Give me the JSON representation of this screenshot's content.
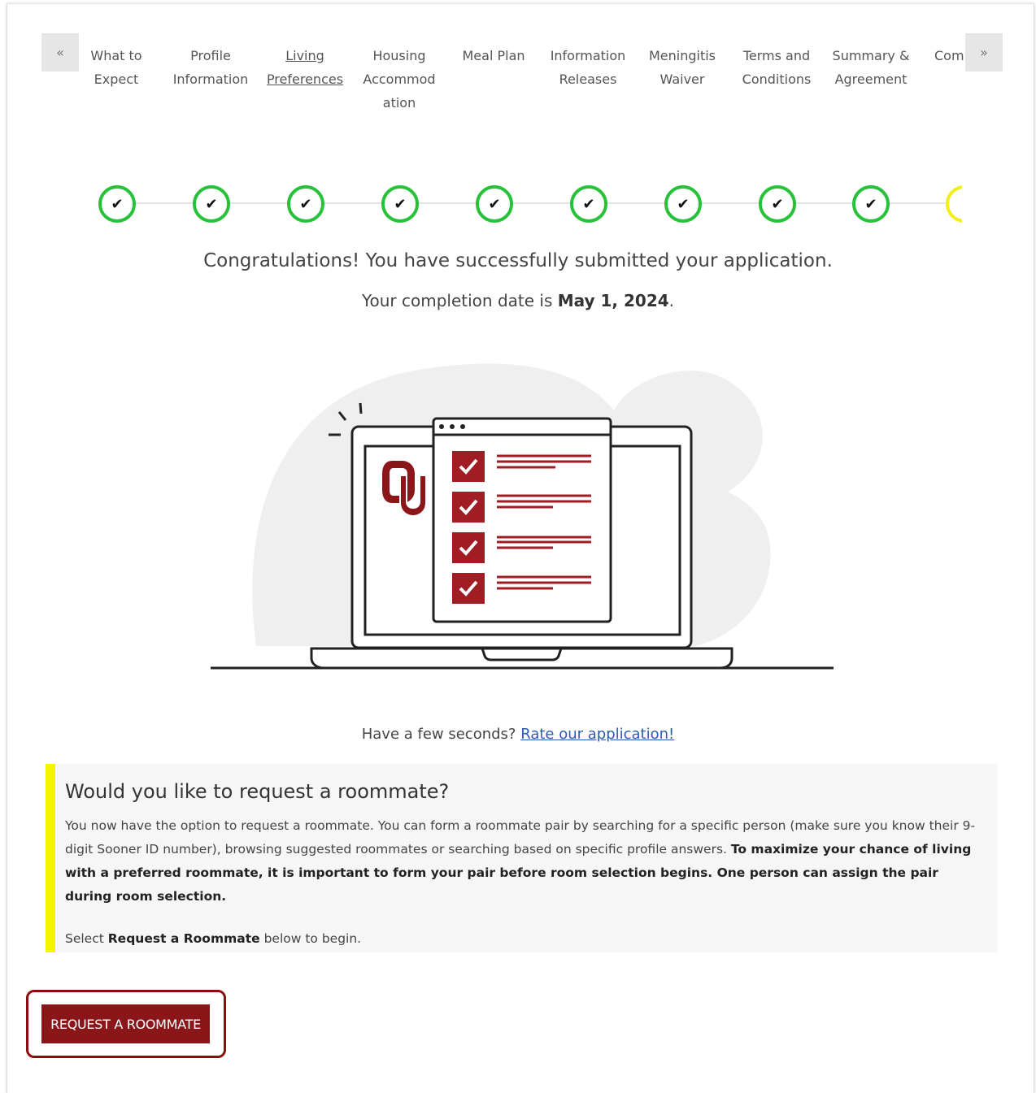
{
  "nav": {
    "prev_label": "«",
    "next_label": "»"
  },
  "steps": {
    "tabs": [
      {
        "label": "What to Expect"
      },
      {
        "label": "Profile Information"
      },
      {
        "label": "Living Preferences"
      },
      {
        "label": "Housing Accommod ation"
      },
      {
        "label": "Meal Plan"
      },
      {
        "label": "Information Releases"
      },
      {
        "label": "Meningitis Waiver"
      },
      {
        "label": "Terms and Conditions"
      },
      {
        "label": "Summary & Agreement"
      },
      {
        "label": "Com"
      }
    ],
    "active_index": 2,
    "check_glyph": "✔",
    "complete_color": "#27c23a",
    "current_color": "#f2ee1c"
  },
  "confirmation": {
    "message": "Congratulations! You have successfully submitted your application.",
    "date_prefix": "Your completion date is ",
    "date": "May 1, 2024",
    "date_suffix": "."
  },
  "illustration": {
    "logo_text": "OU"
  },
  "rate": {
    "prefix": "Have a few seconds? ",
    "link": "Rate our application!"
  },
  "roommate": {
    "title": "Would you like to request a roommate?",
    "body": "You now have the option to request a roommate. You can form a roommate pair by searching for a specific person (make sure you know their 9-digit Sooner ID number), browsing suggested roommates or searching based on specific profile answers. ",
    "body_bold": "To maximize your chance of living with a preferred roommate, it is important to form your pair before room selection begins. One person can assign the pair during room selection.",
    "instruction_prefix": "Select ",
    "instruction_bold": "Request a Roommate",
    "instruction_suffix": " below to begin.",
    "button_label": "REQUEST A ROOMMATE",
    "accent_color": "#8b161a",
    "callout_bar_color": "#f5f500"
  }
}
